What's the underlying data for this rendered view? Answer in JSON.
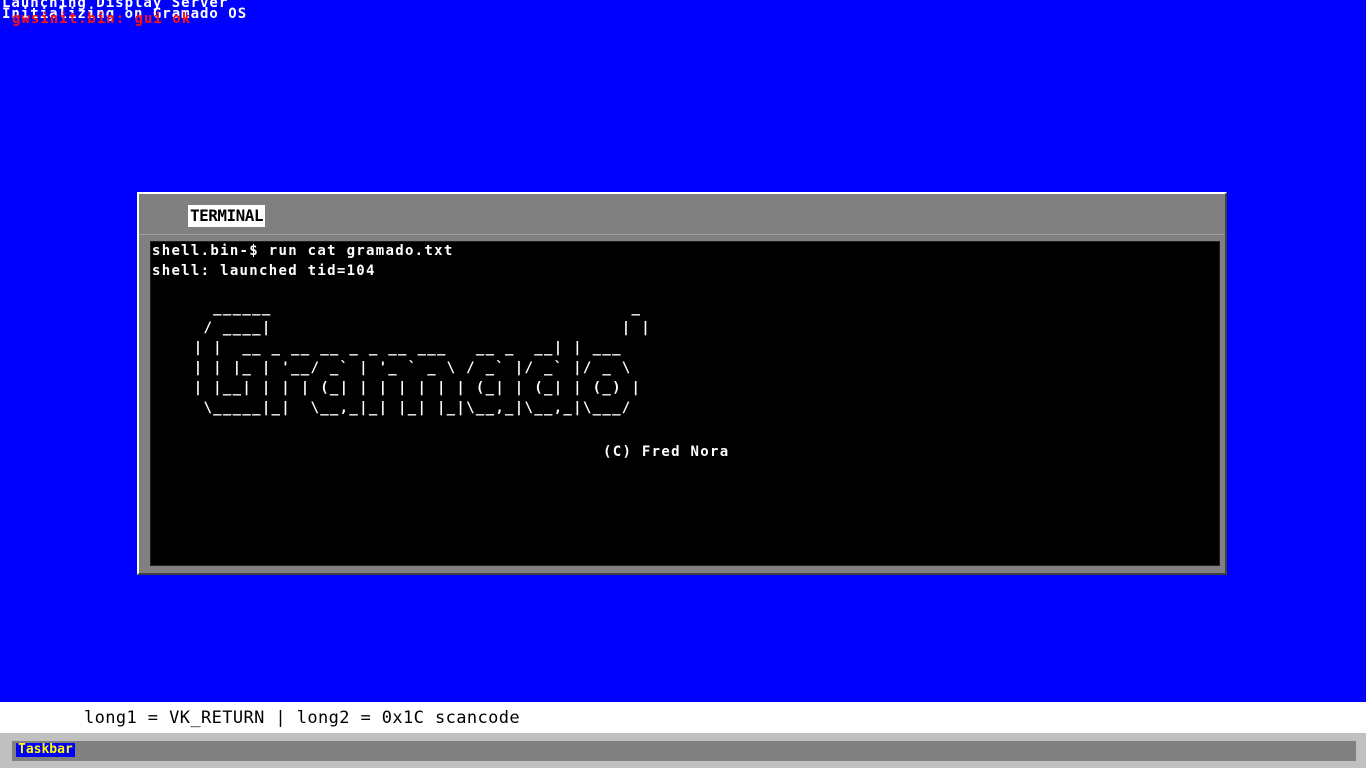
{
  "boot_messages": [
    "Launching Display Server",
    "Initializing on Gramado OS",
    "gwsinit.bin: gui ok"
  ],
  "colors": {
    "desktop": "#0000fe",
    "boot_error_text": "#ff1010",
    "window_frame": "#808080",
    "terminal_bg": "#000000",
    "taskbar_button_text": "#ffff00"
  },
  "window": {
    "title": "TERMINAL"
  },
  "terminal": {
    "lines": [
      "shell.bin-$ run cat gramado.txt",
      "shell: launched tid=104"
    ],
    "ascii_art": "   ______                                     _\n  / ____|                                    | |\n | |  __ _ __ __ _ _ __ ___   __ _  __| | ___\n | | |_ | '__/ _` | '_ ` _ \\ / _` |/ _` |/ _ \\\n | |__| | | | (_| | | | | | | (_| | (_| | (_) |\n  \\_____|_|  \\__,_|_| |_| |_|\\__,_|\\__,_|\\___/",
    "copyright": "(C) Fred Nora"
  },
  "status_bar": {
    "text": "long1 = VK_RETURN | long2 = 0x1C scancode"
  },
  "taskbar": {
    "label": "Taskbar"
  }
}
